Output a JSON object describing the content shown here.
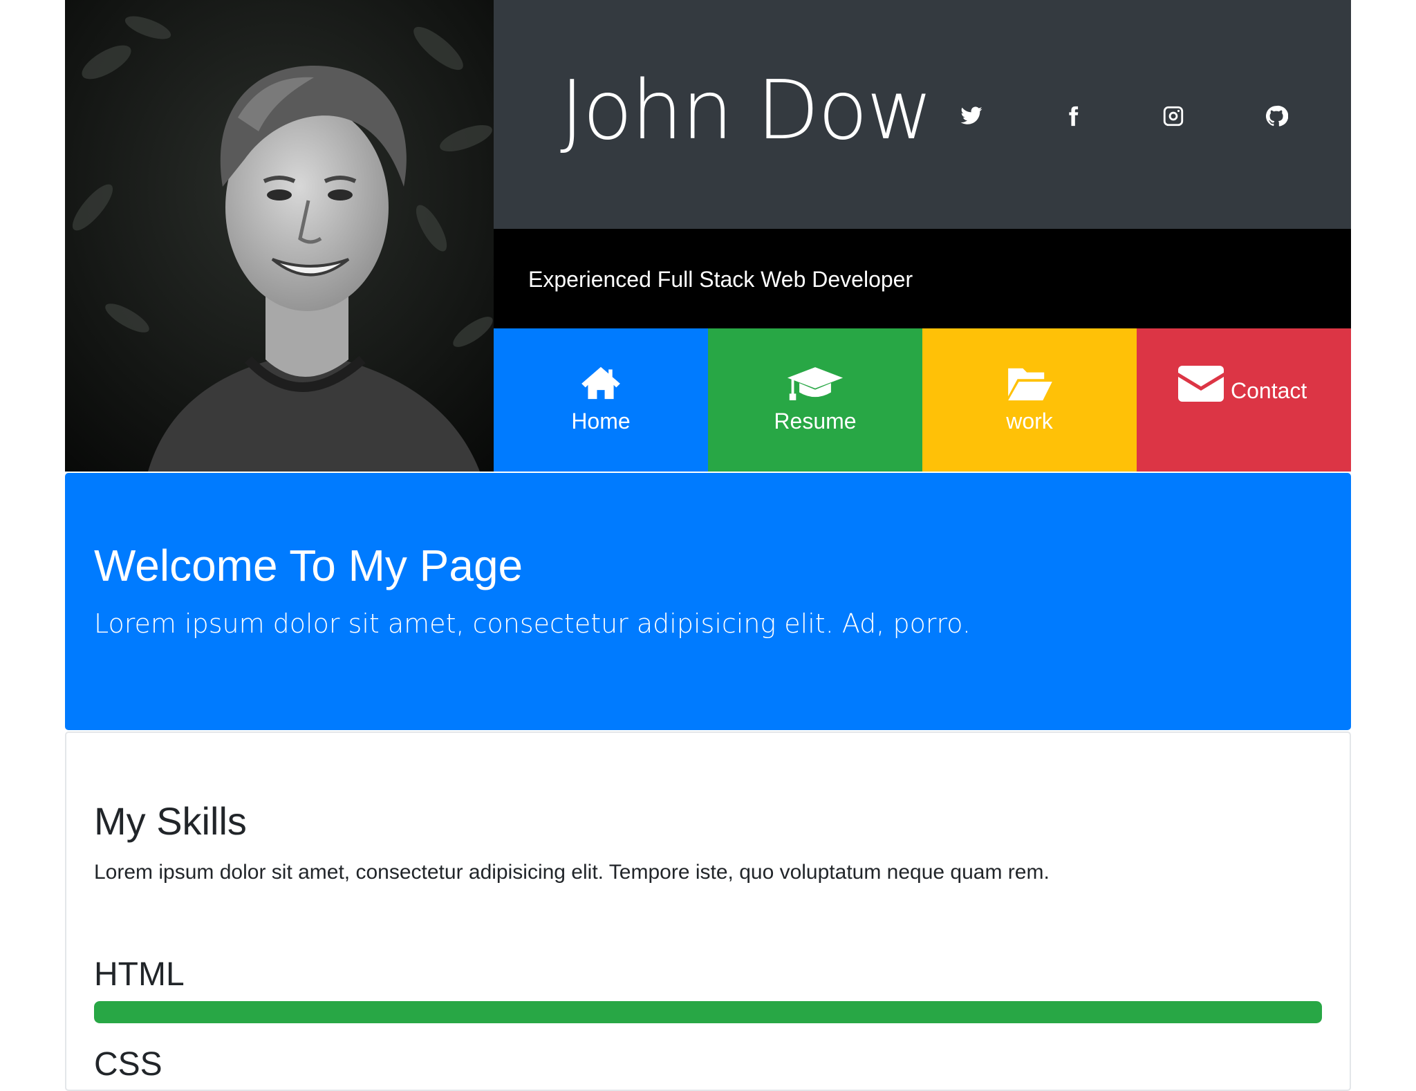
{
  "header": {
    "name": "John Dow",
    "subtitle": "Experienced Full Stack Web Developer",
    "photo_alt": "portrait of a smiling young man, black and white",
    "social": [
      {
        "icon": "twitter-icon"
      },
      {
        "icon": "facebook-icon"
      },
      {
        "icon": "instagram-icon"
      },
      {
        "icon": "github-icon"
      }
    ]
  },
  "nav": [
    {
      "label": "Home",
      "icon": "home-icon",
      "color": "#007bff"
    },
    {
      "label": "Resume",
      "icon": "graduation-cap-icon",
      "color": "#28a745"
    },
    {
      "label": "work",
      "icon": "folder-open-icon",
      "color": "#ffc107"
    },
    {
      "label": "Contact",
      "icon": "envelope-icon",
      "color": "#dc3545"
    }
  ],
  "welcome": {
    "title": "Welcome To My Page",
    "text": "Lorem ipsum dolor sit amet, consectetur adipisicing elit. Ad, porro."
  },
  "skills": {
    "title": "My Skills",
    "text": "Lorem ipsum dolor sit amet, consectetur adipisicing elit. Tempore iste, quo voluptatum neque quam rem.",
    "items": [
      {
        "name": "HTML",
        "level_percent": 100,
        "bar_color": "#28a745"
      },
      {
        "name": "CSS"
      }
    ]
  },
  "colors": {
    "title_bar": "#343a40",
    "subtitle_bar": "#000000",
    "primary": "#007bff"
  }
}
